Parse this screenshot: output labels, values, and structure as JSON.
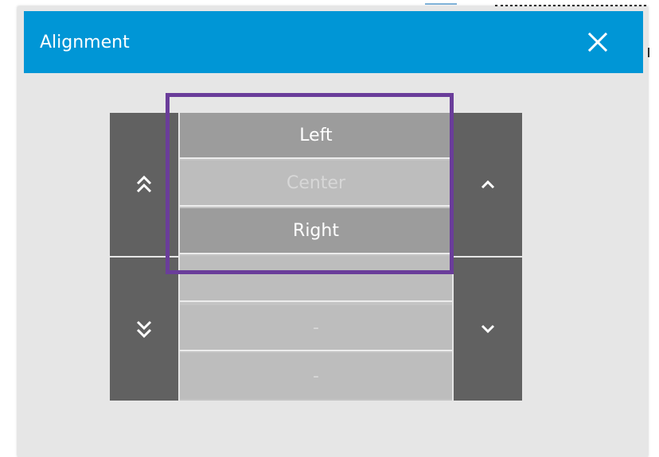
{
  "dialog": {
    "title": "Alignment",
    "colors": {
      "titlebar": "#0096d6",
      "body": "#e6e6e6",
      "button": "#616161",
      "selected_row": "#9c9c9c",
      "disabled_row": "#bdbdbd",
      "highlight": "#6a3d9a"
    }
  },
  "icons": {
    "close": "close-icon",
    "page_up": "double-chevron-up-icon",
    "page_down": "double-chevron-down-icon",
    "step_up": "chevron-up-icon",
    "step_down": "chevron-down-icon"
  },
  "options": [
    {
      "label": "Left",
      "enabled": true
    },
    {
      "label": "Center",
      "enabled": false
    },
    {
      "label": "Right",
      "enabled": true
    },
    {
      "label": "",
      "enabled": false
    },
    {
      "label": "-",
      "enabled": false
    },
    {
      "label": "-",
      "enabled": false
    }
  ]
}
